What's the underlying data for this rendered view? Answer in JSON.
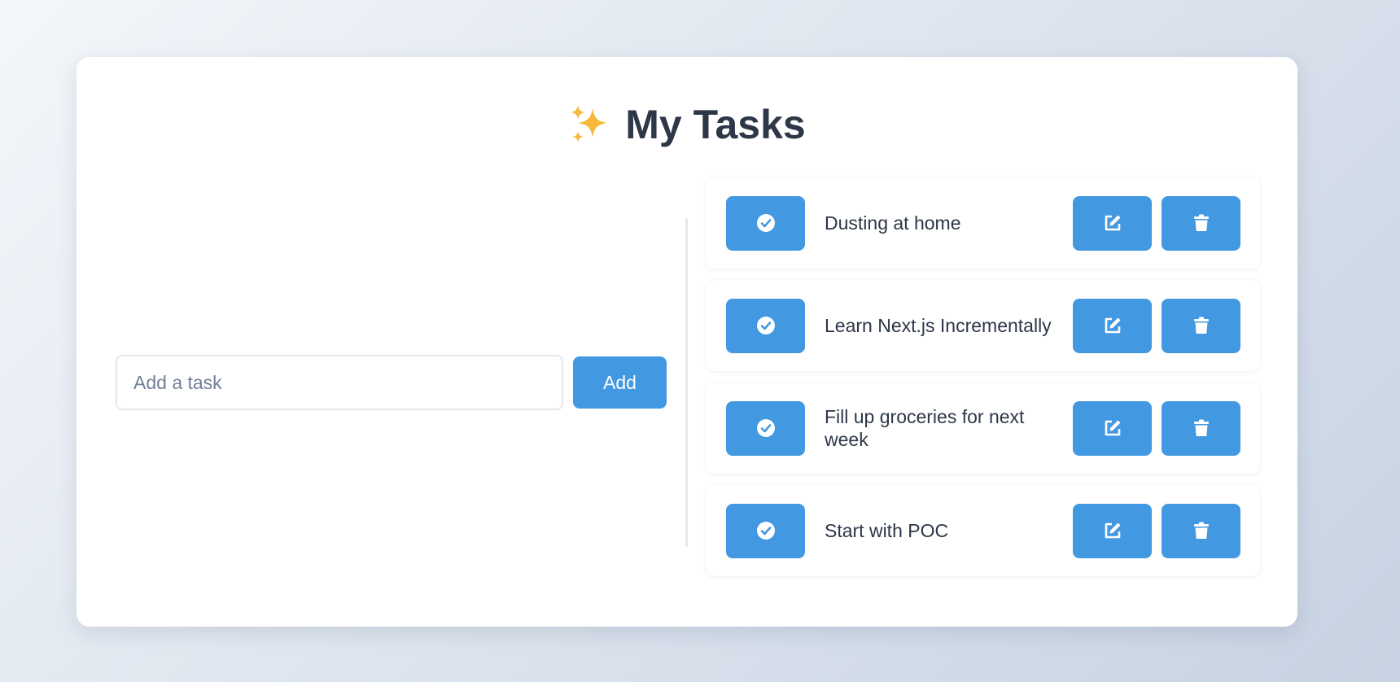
{
  "header": {
    "title": "My Tasks",
    "emoji_icon": "sparkles-icon"
  },
  "add_form": {
    "placeholder": "Add a task",
    "value": "",
    "button_label": "Add"
  },
  "tasks": [
    {
      "text": "Dusting at home"
    },
    {
      "text": "Learn Next.js Incrementally"
    },
    {
      "text": "Fill up groceries for next week"
    },
    {
      "text": "Start with POC"
    }
  ],
  "icons": {
    "complete": "check-circle-icon",
    "edit": "edit-icon",
    "delete": "trash-icon"
  },
  "colors": {
    "accent": "#4299e1",
    "text": "#2d3748",
    "border": "#e2e8f0"
  }
}
